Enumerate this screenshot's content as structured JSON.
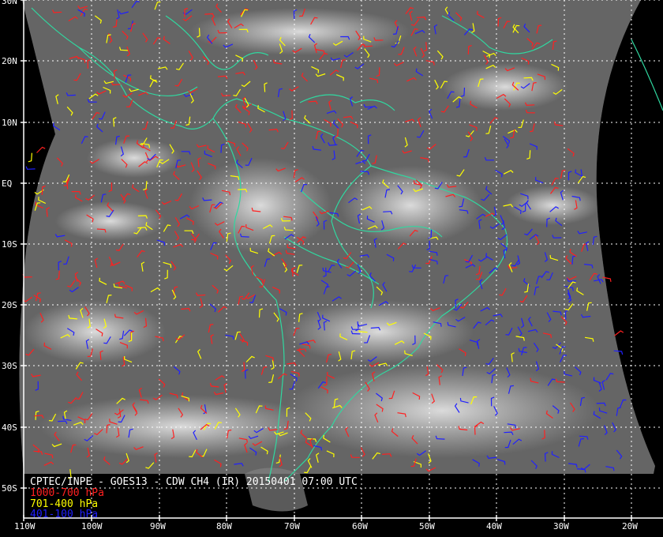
{
  "map": {
    "credit": "CPTEC/INPE - GOES13 - CDW CH4 (IR) 20150401 07:00 UTC",
    "legend": [
      {
        "label": "1000-700 hPa",
        "color": "#ff2020"
      },
      {
        "label": "701-400 hPa",
        "color": "#ffff00"
      },
      {
        "label": "401-100 hPa",
        "color": "#2020ff"
      }
    ],
    "lat_labels": [
      "30N",
      "20N",
      "10N",
      "EQ",
      "10S",
      "20S",
      "30S",
      "40S",
      "50S"
    ],
    "lon_labels": [
      "110W",
      "100W",
      "90W",
      "80W",
      "70W",
      "60W",
      "50W",
      "40W",
      "30W",
      "20W"
    ],
    "colors": {
      "coast": "#30d8a0",
      "grid": "#ffffff",
      "frame": "#ffffff",
      "space": "#000000"
    }
  }
}
